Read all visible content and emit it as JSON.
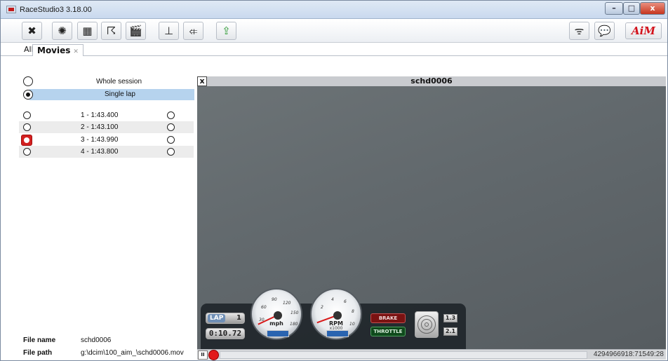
{
  "window": {
    "title": "RaceStudio3 3.18.00",
    "minimize": "–",
    "maximize": "□",
    "close": "x"
  },
  "toolbar": {
    "buttons": [
      {
        "icon": "wrench-icon",
        "glyph": "✖"
      },
      {
        "icon": "engine-icon",
        "glyph": "✺"
      },
      {
        "icon": "dashboard-icon",
        "glyph": "▦"
      },
      {
        "icon": "track-map-icon",
        "glyph": "☈"
      },
      {
        "icon": "movie-clapper-icon",
        "glyph": "🎬"
      },
      {
        "icon": "download-icon",
        "glyph": "⊥"
      },
      {
        "icon": "connect-icon",
        "glyph": "⤂"
      },
      {
        "icon": "export-icon",
        "glyph": "⇪"
      }
    ],
    "wifi_glyph": "ᯤ",
    "chat_glyph": "💬",
    "logo_text": "AiM"
  },
  "tabs": {
    "all_label": "All",
    "movies_label": "Movies",
    "movies_close": "✕"
  },
  "left": {
    "whole_session": "Whole session",
    "single_lap": "Single lap",
    "laps": [
      {
        "label": "1 - 1:43.400",
        "selected": false
      },
      {
        "label": "2 - 1:43.100",
        "selected": false
      },
      {
        "label": "3 - 1:43.990",
        "selected": true
      },
      {
        "label": "4 - 1:43.800",
        "selected": false
      }
    ],
    "file_name_label": "File name",
    "file_name_value": "schd0006",
    "file_path_label": "File path",
    "file_path_value": "g:\\dcim\\100_aim_\\schd0006.mov"
  },
  "video": {
    "close": "x",
    "title": "schd0006",
    "overlay": {
      "lap_tag": "LAP",
      "lap_number": "1",
      "lap_time": "0:10.72",
      "speed_unit": "mph",
      "rpm_label": "RPM",
      "rpm_multiplier": "x1000",
      "speed_ticks": [
        "30",
        "60",
        "90",
        "120",
        "150",
        "180"
      ],
      "rpm_ticks": [
        "2",
        "4",
        "6",
        "8",
        "10"
      ],
      "brake_label": "BRAKE",
      "throttle_label": "THROTTLE",
      "gforce_lat": "1.3",
      "gforce_lon": "2.1"
    }
  },
  "playbar": {
    "pause_glyph": "II",
    "position": "4294966918:71549:28"
  }
}
